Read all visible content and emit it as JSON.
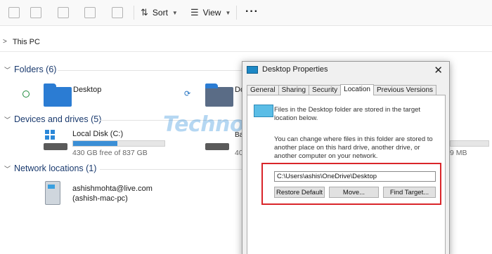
{
  "toolbar": {
    "sort_label": "Sort",
    "view_label": "View",
    "icons": [
      "new-icon",
      "copy-icon",
      "rename-icon",
      "share-icon",
      "delete-icon",
      "sort-icon",
      "view-icon",
      "more-icon"
    ]
  },
  "address": {
    "crumb": "This PC"
  },
  "groups": {
    "folders": {
      "header": "Folders (6)",
      "items": [
        {
          "label": "Desktop"
        },
        {
          "label": "Do"
        }
      ]
    },
    "devices": {
      "header": "Devices and drives (5)",
      "local_disk": {
        "label": "Local Disk (C:)",
        "free": "430 GB free of 837 GB",
        "used_fraction": 0.486
      },
      "drive2_label": "Ba",
      "drive2_free": "40",
      "drive3_free": "9 MB"
    },
    "network": {
      "header": "Network locations (1)",
      "item": {
        "name": "ashishmohta@live.com",
        "host": "(ashish-mac-pc)"
      }
    }
  },
  "dialog": {
    "title": "Desktop Properties",
    "close": "✕",
    "tabs": [
      "General",
      "Sharing",
      "Security",
      "Location",
      "Previous Versions"
    ],
    "active_tab": "Location",
    "text1": "Files in the Desktop folder are stored in the target location below.",
    "text2": "You can change where files in this folder are stored to another place on this hard drive, another drive, or another computer on your network.",
    "path_value": "C:\\Users\\ashis\\OneDrive\\Desktop",
    "buttons": {
      "restore": "Restore Default",
      "move": "Move...",
      "find": "Find Target..."
    }
  },
  "watermark": "Technospot.Net",
  "colors": {
    "accent": "#2b7cd3",
    "highlight": "#d9252a",
    "header_text": "#1a3a6e"
  }
}
